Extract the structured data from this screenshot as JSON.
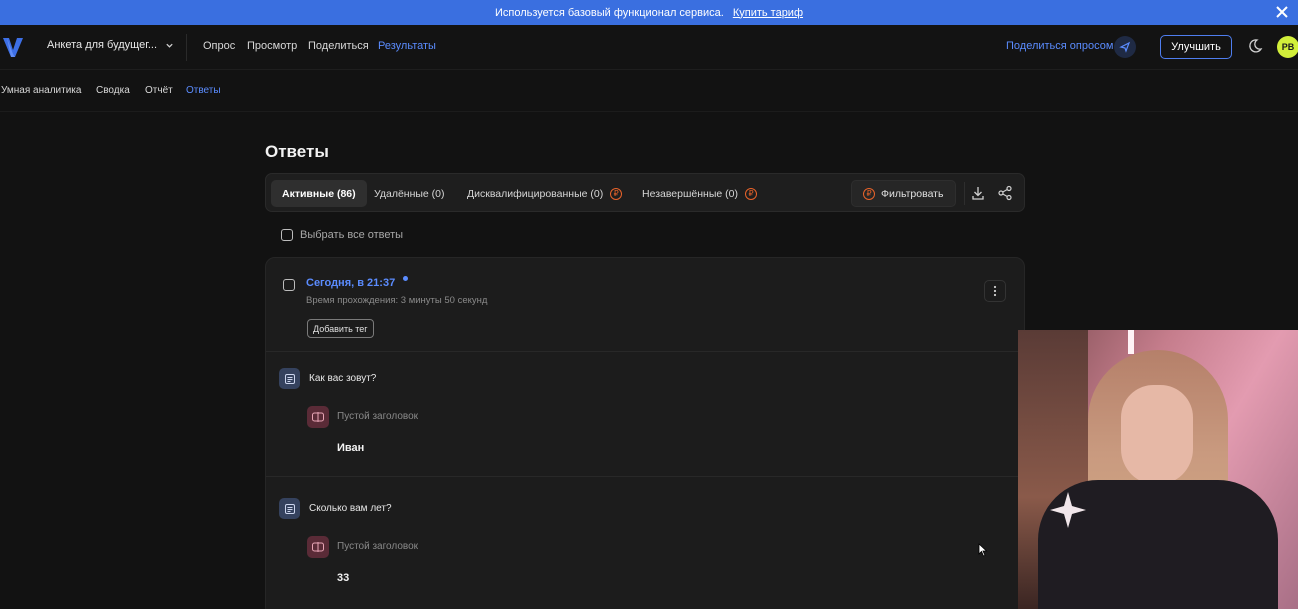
{
  "banner": {
    "text": "Используется базовый функционал сервиса.",
    "link": "Купить тариф"
  },
  "header": {
    "survey_name": "Анкета для будущег...",
    "nav": [
      "Опрос",
      "Просмотр",
      "Поделиться",
      "Результаты"
    ],
    "active_nav": "Результаты",
    "share_survey": "Поделиться опросом",
    "upgrade": "Улучшить",
    "avatar_initials": "PB"
  },
  "subnav": {
    "items": [
      "Умная аналитика",
      "Сводка",
      "Отчёт",
      "Ответы"
    ],
    "active": "Ответы"
  },
  "page": {
    "title": "Ответы",
    "tabs": [
      {
        "label": "Активные (86)",
        "active": true,
        "paid": false
      },
      {
        "label": "Удалённые (0)",
        "active": false,
        "paid": false
      },
      {
        "label": "Дисквалифицированные (0)",
        "active": false,
        "paid": true
      },
      {
        "label": "Незавершённые (0)",
        "active": false,
        "paid": true
      }
    ],
    "paid_badge": "₽",
    "filter": "Фильтровать",
    "select_all": "Выбрать все ответы"
  },
  "response": {
    "date": "Сегодня, в 21:37",
    "duration": "Время прохождения: 3 минуты 50 секунд",
    "add_tag": "Добавить тег",
    "questions": [
      {
        "question": "Как вас зовут?",
        "answer_label": "Пустой заголовок",
        "answer": "Иван"
      },
      {
        "question": "Сколько вам лет?",
        "answer_label": "Пустой заголовок",
        "answer": "33"
      }
    ]
  },
  "colors": {
    "banner": "#3a6fe0",
    "accent": "#5b8cff",
    "paid_badge": "#e8632a",
    "avatar": "#d2ef3a"
  }
}
